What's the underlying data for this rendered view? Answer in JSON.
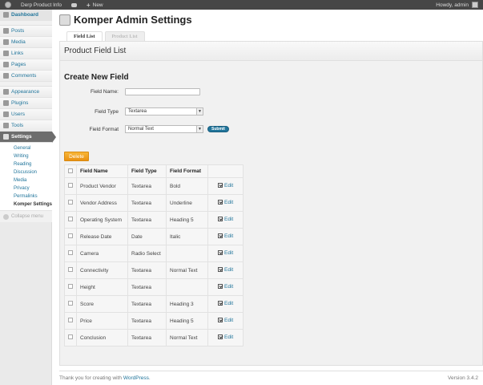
{
  "adminbar": {
    "site_name": "Derp Product Info",
    "new_label": "New",
    "howdy": "Howdy, admin"
  },
  "menu": {
    "dashboard": "Dashboard",
    "posts": "Posts",
    "media": "Media",
    "links": "Links",
    "pages": "Pages",
    "comments": "Comments",
    "appearance": "Appearance",
    "plugins": "Plugins",
    "users": "Users",
    "tools": "Tools",
    "settings": "Settings",
    "submenu": [
      "General",
      "Writing",
      "Reading",
      "Discussion",
      "Media",
      "Privacy",
      "Permalinks",
      "Komper Settings"
    ],
    "collapse": "Collapse menu"
  },
  "page": {
    "title": "Komper Admin Settings",
    "tabs": [
      "Field List",
      "Product List"
    ],
    "panel_title": "Product Field List"
  },
  "form": {
    "title": "Create New Field",
    "field_name_label": "Field Name:",
    "field_name_value": "",
    "field_type_label": "Field Type",
    "field_type_value": "Textarea",
    "field_format_label": "Field Format",
    "field_format_value": "Normal Text",
    "submit_label": "Submit"
  },
  "table": {
    "delete_label": "Delete",
    "headers": [
      "Field Name",
      "Field Type",
      "Field Format"
    ],
    "edit_label": "Edit",
    "rows": [
      {
        "name": "Product Vendor",
        "type": "Textarea",
        "format": "Bold"
      },
      {
        "name": "Vendor Address",
        "type": "Textarea",
        "format": "Underline"
      },
      {
        "name": "Operating System",
        "type": "Textarea",
        "format": "Heading 5"
      },
      {
        "name": "Release Date",
        "type": "Date",
        "format": "Italic"
      },
      {
        "name": "Camera",
        "type": "Radio Select",
        "format": ""
      },
      {
        "name": "Connectivity",
        "type": "Textarea",
        "format": "Normal Text"
      },
      {
        "name": "Height",
        "type": "Textarea",
        "format": ""
      },
      {
        "name": "Score",
        "type": "Textarea",
        "format": "Heading 3"
      },
      {
        "name": "Price",
        "type": "Textarea",
        "format": "Heading 5"
      },
      {
        "name": "Conclusion",
        "type": "Textarea",
        "format": "Normal Text"
      }
    ]
  },
  "footer": {
    "thanks_prefix": "Thank you for creating with ",
    "wordpress_link": "WordPress",
    "thanks_suffix": ".",
    "version": "Version 3.4.2"
  }
}
